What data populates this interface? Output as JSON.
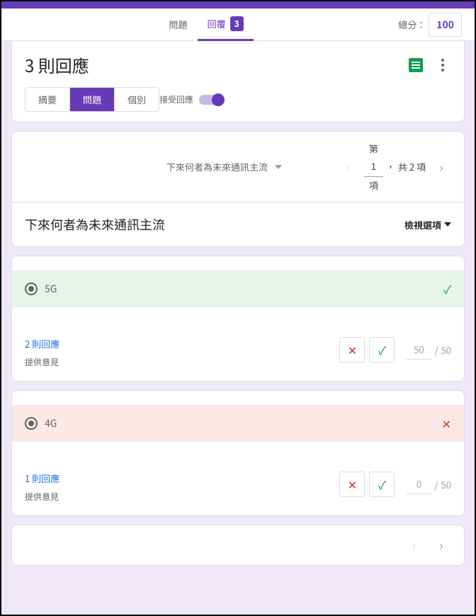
{
  "tabs": {
    "questions": "問題",
    "responses": "回覆",
    "responses_badge": "3"
  },
  "score": {
    "label": "總分：",
    "value": "100"
  },
  "header": {
    "title": "3 則回應",
    "view_summary": "摘要",
    "view_question": "問題",
    "view_individual": "個別",
    "accept_label": "接受回應"
  },
  "qnav": {
    "question_select": "下來何者為未來通訊主流",
    "prefix": "第",
    "page": "1",
    "total": "共 2 項",
    "suffix": "項"
  },
  "question": {
    "title": "下來何者為未來通訊主流",
    "view_options": "檢視選項"
  },
  "answers": [
    {
      "text": "5G",
      "correct": true,
      "responses_label": "2 則回應",
      "feedback_label": "提供意見",
      "points_value": "50",
      "points_max": "50"
    },
    {
      "text": "4G",
      "correct": false,
      "responses_label": "1 則回應",
      "feedback_label": "提供意見",
      "points_value": "0",
      "points_max": "50"
    }
  ]
}
